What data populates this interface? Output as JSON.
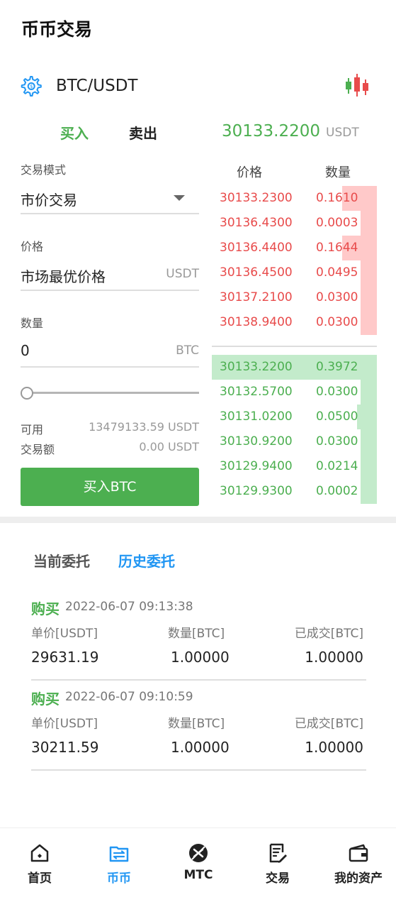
{
  "header": {
    "title": "币币交易"
  },
  "pair": {
    "name": "BTC/USDT",
    "settings_icon": "gear-icon",
    "chart_icon": "candlestick-icon"
  },
  "trade_tabs": {
    "buy": "买入",
    "sell": "卖出",
    "active": "buy"
  },
  "last_price": {
    "value": "30133.2200",
    "unit": "USDT"
  },
  "form": {
    "mode_label": "交易模式",
    "mode_value": "市价交易",
    "price_label": "价格",
    "price_value": "市场最优价格",
    "price_unit": "USDT",
    "qty_label": "数量",
    "qty_value": "0",
    "qty_unit": "BTC",
    "slider_percent": 0,
    "available_label": "可用",
    "available_value": "13479133.59 USDT",
    "amount_label": "交易额",
    "amount_value": "0.00 USDT",
    "submit_label": "买入BTC"
  },
  "orderbook": {
    "price_header": "价格",
    "qty_header": "数量",
    "asks": [
      {
        "price": "30133.2300",
        "qty": "0.1610",
        "depth": 0.21
      },
      {
        "price": "30136.4300",
        "qty": "0.0003",
        "depth": 0.1
      },
      {
        "price": "30136.4400",
        "qty": "0.1644",
        "depth": 0.21
      },
      {
        "price": "30136.4500",
        "qty": "0.0495",
        "depth": 0.1
      },
      {
        "price": "30137.2100",
        "qty": "0.0300",
        "depth": 0.1
      },
      {
        "price": "30138.9400",
        "qty": "0.0300",
        "depth": 0.1
      }
    ],
    "bids": [
      {
        "price": "30133.2200",
        "qty": "0.3972",
        "depth": 1.0
      },
      {
        "price": "30132.5700",
        "qty": "0.0300",
        "depth": 0.1
      },
      {
        "price": "30131.0200",
        "qty": "0.0500",
        "depth": 0.12
      },
      {
        "price": "30130.9200",
        "qty": "0.0300",
        "depth": 0.1
      },
      {
        "price": "30129.9400",
        "qty": "0.0214",
        "depth": 0.1
      },
      {
        "price": "30129.9300",
        "qty": "0.0002",
        "depth": 0.1
      }
    ],
    "ask_color": "#ffc9c9",
    "bid_color": "#c3ebcb"
  },
  "orders_tabs": {
    "current": "当前委托",
    "history": "历史委托",
    "active": "history"
  },
  "orders": [
    {
      "side": "购买",
      "time": "2022-06-07 09:13:38",
      "h_price": "单价[USDT]",
      "h_qty": "数量[BTC]",
      "h_filled": "已成交[BTC]",
      "price": "29631.19",
      "qty": "1.00000",
      "filled": "1.00000"
    },
    {
      "side": "购买",
      "time": "2022-06-07 09:10:59",
      "h_price": "单价[USDT]",
      "h_qty": "数量[BTC]",
      "h_filled": "已成交[BTC]",
      "price": "30211.59",
      "qty": "1.00000",
      "filled": "1.00000"
    }
  ],
  "nav": [
    {
      "label": "首页",
      "icon": "home-icon"
    },
    {
      "label": "币币",
      "icon": "exchange-icon",
      "active": true
    },
    {
      "label": "MTC",
      "icon": "mtc-coin-icon"
    },
    {
      "label": "交易",
      "icon": "trade-document-icon"
    },
    {
      "label": "我的资产",
      "icon": "wallet-icon"
    }
  ],
  "colors": {
    "green": "#4caf50",
    "red": "#e84b4b",
    "blue": "#2196f3"
  }
}
